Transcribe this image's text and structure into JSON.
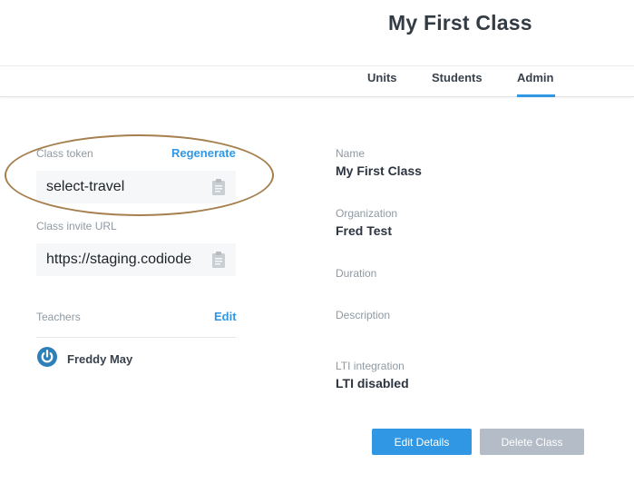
{
  "header": {
    "title": "My First Class"
  },
  "tabs": [
    {
      "label": "Units"
    },
    {
      "label": "Students"
    },
    {
      "label": "Admin",
      "active": true
    }
  ],
  "left": {
    "class_token": {
      "label": "Class token",
      "action": "Regenerate",
      "value": "select-travel"
    },
    "invite_url": {
      "label": "Class invite URL",
      "value": "https://staging.codiode"
    },
    "teachers": {
      "label": "Teachers",
      "action": "Edit",
      "list": [
        {
          "name": "Freddy May"
        }
      ]
    }
  },
  "details": {
    "name": {
      "label": "Name",
      "value": "My First Class"
    },
    "organization": {
      "label": "Organization",
      "value": "Fred Test"
    },
    "duration": {
      "label": "Duration",
      "value": ""
    },
    "description": {
      "label": "Description",
      "value": ""
    },
    "lti": {
      "label": "LTI integration",
      "value": "LTI disabled"
    }
  },
  "buttons": {
    "edit_details": "Edit Details",
    "delete_class": "Delete Class"
  },
  "colors": {
    "accent": "#2f97e3",
    "disabled_button": "#b3bcc7",
    "annotation": "#a57f4e"
  },
  "icons": {
    "copy": "clipboard-icon",
    "teacher": "power-icon"
  }
}
